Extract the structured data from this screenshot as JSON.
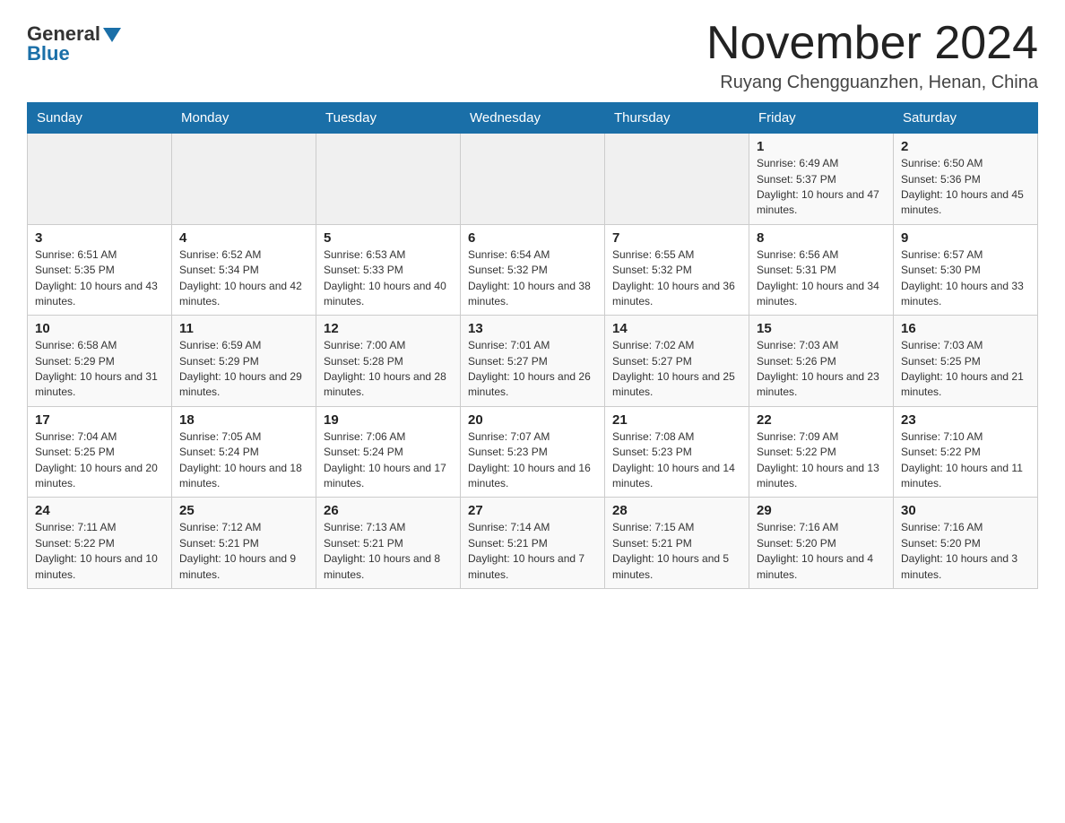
{
  "header": {
    "logo_general": "General",
    "logo_blue": "Blue",
    "title": "November 2024",
    "location": "Ruyang Chengguanzhen, Henan, China"
  },
  "days_of_week": [
    "Sunday",
    "Monday",
    "Tuesday",
    "Wednesday",
    "Thursday",
    "Friday",
    "Saturday"
  ],
  "weeks": [
    [
      {
        "day": "",
        "info": ""
      },
      {
        "day": "",
        "info": ""
      },
      {
        "day": "",
        "info": ""
      },
      {
        "day": "",
        "info": ""
      },
      {
        "day": "",
        "info": ""
      },
      {
        "day": "1",
        "info": "Sunrise: 6:49 AM\nSunset: 5:37 PM\nDaylight: 10 hours and 47 minutes."
      },
      {
        "day": "2",
        "info": "Sunrise: 6:50 AM\nSunset: 5:36 PM\nDaylight: 10 hours and 45 minutes."
      }
    ],
    [
      {
        "day": "3",
        "info": "Sunrise: 6:51 AM\nSunset: 5:35 PM\nDaylight: 10 hours and 43 minutes."
      },
      {
        "day": "4",
        "info": "Sunrise: 6:52 AM\nSunset: 5:34 PM\nDaylight: 10 hours and 42 minutes."
      },
      {
        "day": "5",
        "info": "Sunrise: 6:53 AM\nSunset: 5:33 PM\nDaylight: 10 hours and 40 minutes."
      },
      {
        "day": "6",
        "info": "Sunrise: 6:54 AM\nSunset: 5:32 PM\nDaylight: 10 hours and 38 minutes."
      },
      {
        "day": "7",
        "info": "Sunrise: 6:55 AM\nSunset: 5:32 PM\nDaylight: 10 hours and 36 minutes."
      },
      {
        "day": "8",
        "info": "Sunrise: 6:56 AM\nSunset: 5:31 PM\nDaylight: 10 hours and 34 minutes."
      },
      {
        "day": "9",
        "info": "Sunrise: 6:57 AM\nSunset: 5:30 PM\nDaylight: 10 hours and 33 minutes."
      }
    ],
    [
      {
        "day": "10",
        "info": "Sunrise: 6:58 AM\nSunset: 5:29 PM\nDaylight: 10 hours and 31 minutes."
      },
      {
        "day": "11",
        "info": "Sunrise: 6:59 AM\nSunset: 5:29 PM\nDaylight: 10 hours and 29 minutes."
      },
      {
        "day": "12",
        "info": "Sunrise: 7:00 AM\nSunset: 5:28 PM\nDaylight: 10 hours and 28 minutes."
      },
      {
        "day": "13",
        "info": "Sunrise: 7:01 AM\nSunset: 5:27 PM\nDaylight: 10 hours and 26 minutes."
      },
      {
        "day": "14",
        "info": "Sunrise: 7:02 AM\nSunset: 5:27 PM\nDaylight: 10 hours and 25 minutes."
      },
      {
        "day": "15",
        "info": "Sunrise: 7:03 AM\nSunset: 5:26 PM\nDaylight: 10 hours and 23 minutes."
      },
      {
        "day": "16",
        "info": "Sunrise: 7:03 AM\nSunset: 5:25 PM\nDaylight: 10 hours and 21 minutes."
      }
    ],
    [
      {
        "day": "17",
        "info": "Sunrise: 7:04 AM\nSunset: 5:25 PM\nDaylight: 10 hours and 20 minutes."
      },
      {
        "day": "18",
        "info": "Sunrise: 7:05 AM\nSunset: 5:24 PM\nDaylight: 10 hours and 18 minutes."
      },
      {
        "day": "19",
        "info": "Sunrise: 7:06 AM\nSunset: 5:24 PM\nDaylight: 10 hours and 17 minutes."
      },
      {
        "day": "20",
        "info": "Sunrise: 7:07 AM\nSunset: 5:23 PM\nDaylight: 10 hours and 16 minutes."
      },
      {
        "day": "21",
        "info": "Sunrise: 7:08 AM\nSunset: 5:23 PM\nDaylight: 10 hours and 14 minutes."
      },
      {
        "day": "22",
        "info": "Sunrise: 7:09 AM\nSunset: 5:22 PM\nDaylight: 10 hours and 13 minutes."
      },
      {
        "day": "23",
        "info": "Sunrise: 7:10 AM\nSunset: 5:22 PM\nDaylight: 10 hours and 11 minutes."
      }
    ],
    [
      {
        "day": "24",
        "info": "Sunrise: 7:11 AM\nSunset: 5:22 PM\nDaylight: 10 hours and 10 minutes."
      },
      {
        "day": "25",
        "info": "Sunrise: 7:12 AM\nSunset: 5:21 PM\nDaylight: 10 hours and 9 minutes."
      },
      {
        "day": "26",
        "info": "Sunrise: 7:13 AM\nSunset: 5:21 PM\nDaylight: 10 hours and 8 minutes."
      },
      {
        "day": "27",
        "info": "Sunrise: 7:14 AM\nSunset: 5:21 PM\nDaylight: 10 hours and 7 minutes."
      },
      {
        "day": "28",
        "info": "Sunrise: 7:15 AM\nSunset: 5:21 PM\nDaylight: 10 hours and 5 minutes."
      },
      {
        "day": "29",
        "info": "Sunrise: 7:16 AM\nSunset: 5:20 PM\nDaylight: 10 hours and 4 minutes."
      },
      {
        "day": "30",
        "info": "Sunrise: 7:16 AM\nSunset: 5:20 PM\nDaylight: 10 hours and 3 minutes."
      }
    ]
  ]
}
